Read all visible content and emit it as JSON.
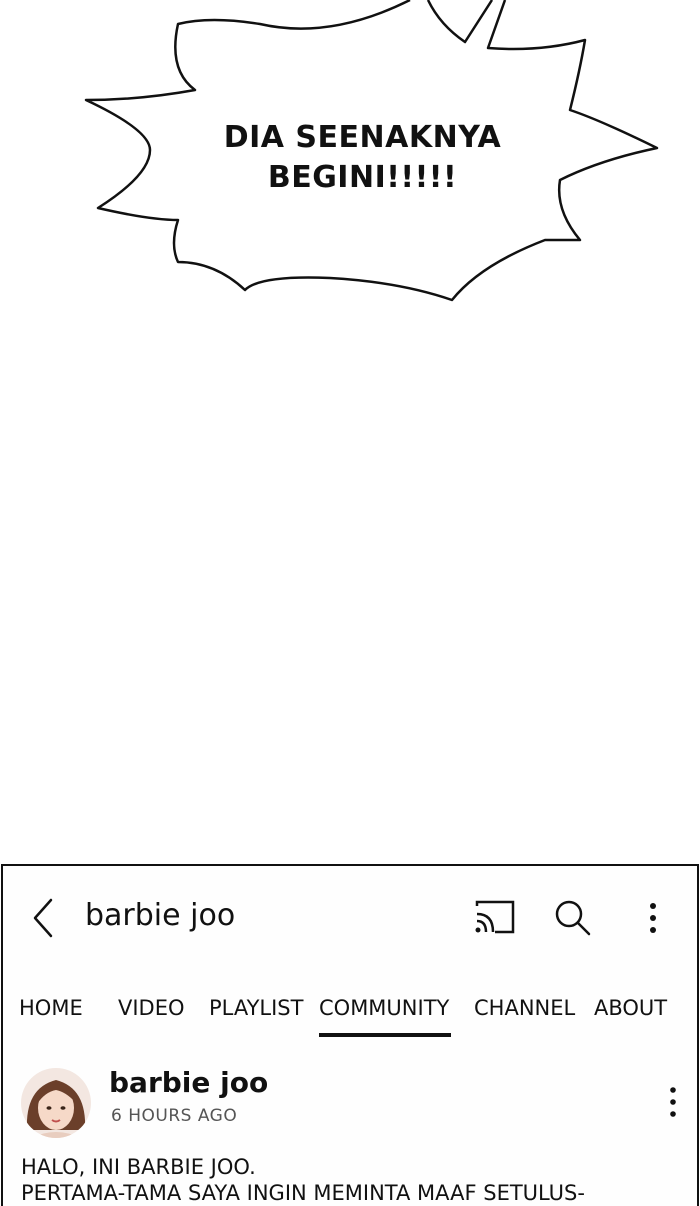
{
  "speech_bubble": {
    "line1": "DIA SEENAKNYA",
    "line2": "BEGINI!!!!!"
  },
  "header": {
    "channel_name": "barbie joo",
    "back_icon": "chevron-left-icon",
    "cast_icon": "cast-icon",
    "search_icon": "search-icon",
    "menu_icon": "more-vertical-icon"
  },
  "tabs": [
    {
      "label": "HOME"
    },
    {
      "label": "VIDEO"
    },
    {
      "label": "PLAYLIST"
    },
    {
      "label": "COMMUNITY",
      "active": true
    },
    {
      "label": "CHANNEL"
    },
    {
      "label": "ABOUT"
    }
  ],
  "post": {
    "author": "barbie joo",
    "time": "6 HOURS AGO",
    "line1": "HALO, INI BARBIE JOO.",
    "line2": "PERTAMA-TAMA SAYA INGIN MEMINTA MAAF SETULUS-"
  },
  "colors": {
    "ink": "#111111",
    "muted": "#555555",
    "background": "#ffffff"
  }
}
